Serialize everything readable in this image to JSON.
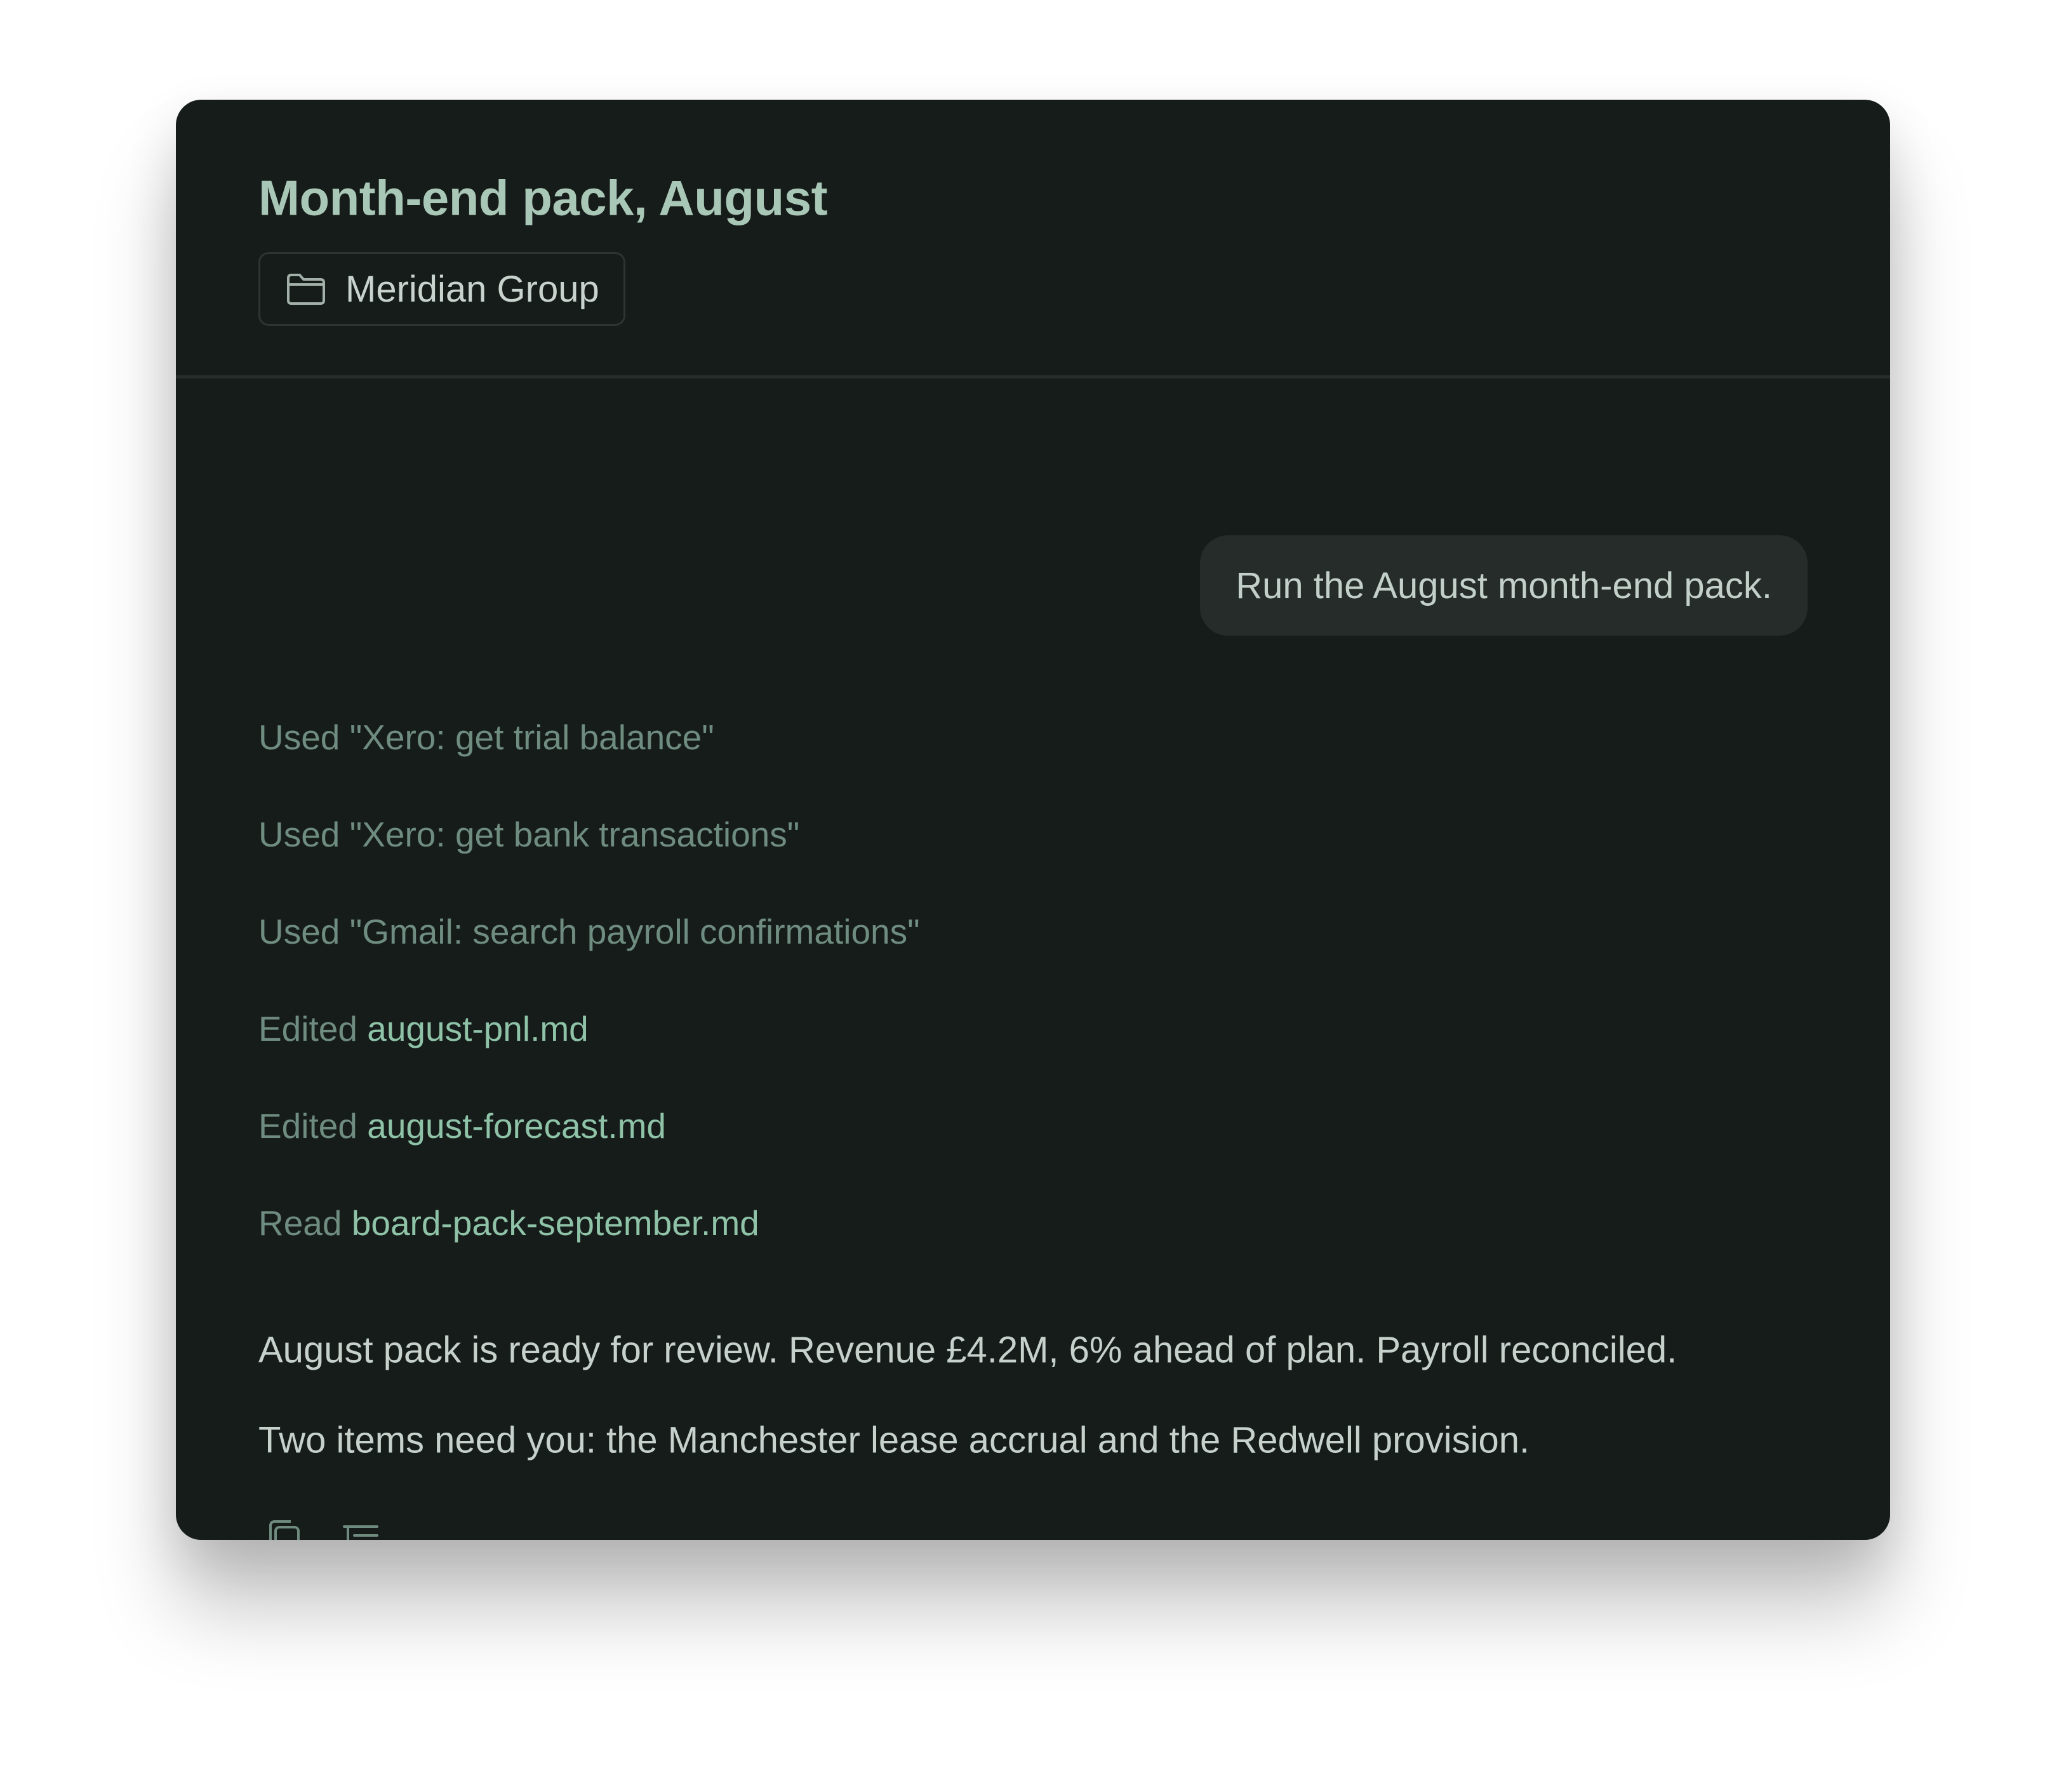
{
  "header": {
    "title": "Month-end pack, August",
    "project": {
      "label": "Meridian Group",
      "icon": "folder-icon"
    }
  },
  "conversation": {
    "user_message": "Run the August month-end pack.",
    "activity": [
      {
        "verb": "Used",
        "target": "\"Xero: get trial balance\"",
        "is_file": false
      },
      {
        "verb": "Used",
        "target": "\"Xero: get bank transactions\"",
        "is_file": false
      },
      {
        "verb": "Used",
        "target": "\"Gmail: search payroll confirmations\"",
        "is_file": false
      },
      {
        "verb": "Edited",
        "target": "august-pnl.md",
        "is_file": true
      },
      {
        "verb": "Edited",
        "target": "august-forecast.md",
        "is_file": true
      },
      {
        "verb": "Read",
        "target": "board-pack-september.md",
        "is_file": true
      }
    ],
    "reply": [
      "August pack is ready for review. Revenue £4.2M, 6% ahead of plan. Payroll reconciled.",
      "Two items need you: the Manchester lease accrual and the Redwell provision."
    ],
    "actions": [
      {
        "icon": "copy-icon"
      },
      {
        "icon": "outline-icon"
      }
    ]
  },
  "colors": {
    "panel_bg": "#161c1a",
    "title": "#a9c7b6",
    "activity_text": "#6f8c80",
    "file_link": "#8fc3a8",
    "body_text": "#c6d1cc",
    "bubble_bg": "#252c2a"
  }
}
